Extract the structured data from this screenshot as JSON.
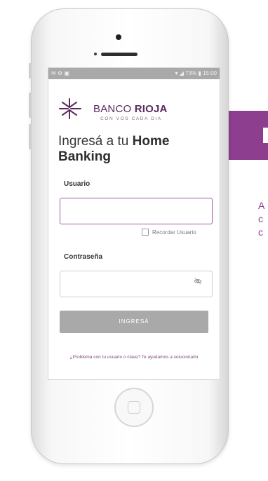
{
  "status_bar": {
    "left": "✉ ⚙ ▣",
    "right": "▾ ◢ 73% ▮ 15:00"
  },
  "brand": {
    "name_regular": "BANCO ",
    "name_bold": "RIOJA",
    "tagline": "CON VOS CADA DIA"
  },
  "heading": {
    "prefix": "Ingresá a tu ",
    "bold": "Home",
    "line2": "Banking"
  },
  "form": {
    "usuario_label": "Usuario",
    "usuario_value": "",
    "remember_label": "Recordar Usuario",
    "password_label": "Contraseña",
    "password_value": "",
    "submit_label": "INGRESÁ"
  },
  "help_text": "¿Problema con tu usuario o clave? Te ayudamos a solucionarlo",
  "side_text": "A\nc\nc",
  "colors": {
    "brand_purple": "#8e3e8f",
    "button_gray": "#a9a9a9"
  },
  "icons": [
    "eye-slash-icon",
    "home-button-icon",
    "banco-rioja-logo"
  ]
}
